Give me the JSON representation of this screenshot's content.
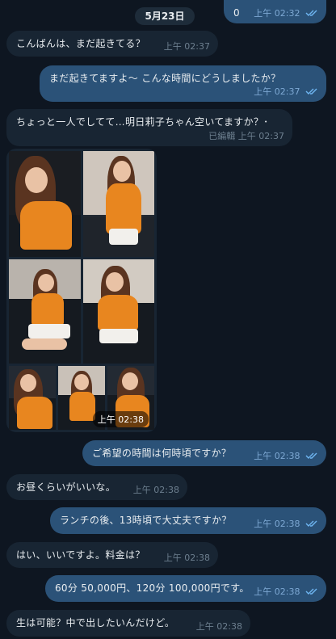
{
  "date_separator": "5月23日",
  "messages": [
    {
      "text": "0",
      "time": "上午 02:32",
      "status": "read"
    },
    {
      "text": "こんばんは、まだ起きてる？",
      "time": "上午 02:37"
    },
    {
      "text": "まだ起きてますよ～ こんな時間にどうしましたか？",
      "time": "上午 02:37",
      "status": "read"
    },
    {
      "text": "ちょっと一人でしてて…明日莉子ちゃん空いてますか？･",
      "edited": "已編輯",
      "time": "上午 02:37"
    },
    {
      "type": "photo-album",
      "photo_count": 7,
      "time": "上午 02:38"
    },
    {
      "text": "ご希望の時間は何時頃ですか？",
      "time": "上午 02:38",
      "status": "read"
    },
    {
      "text": "お昼くらいがいいな。",
      "time": "上午 02:38"
    },
    {
      "text": "ランチの後、13時頃で大丈夫ですか？",
      "time": "上午 02:38",
      "status": "read"
    },
    {
      "text": "はい、いいですよ。料金は？",
      "time": "上午 02:38"
    },
    {
      "text": "60分 50,000円、120分 100,000円です。",
      "time": "上午 02:38",
      "status": "read"
    },
    {
      "text": "生は可能？中で出したいんだけど。",
      "time": "上午 02:38"
    }
  ],
  "colors": {
    "background": "#0e1621",
    "incoming_bubble": "#182533",
    "outgoing_bubble": "#2b5278",
    "read_ticks": "#6fb6f2",
    "accent_top": "#e8861f"
  },
  "icons": [
    "double-check-icon"
  ]
}
